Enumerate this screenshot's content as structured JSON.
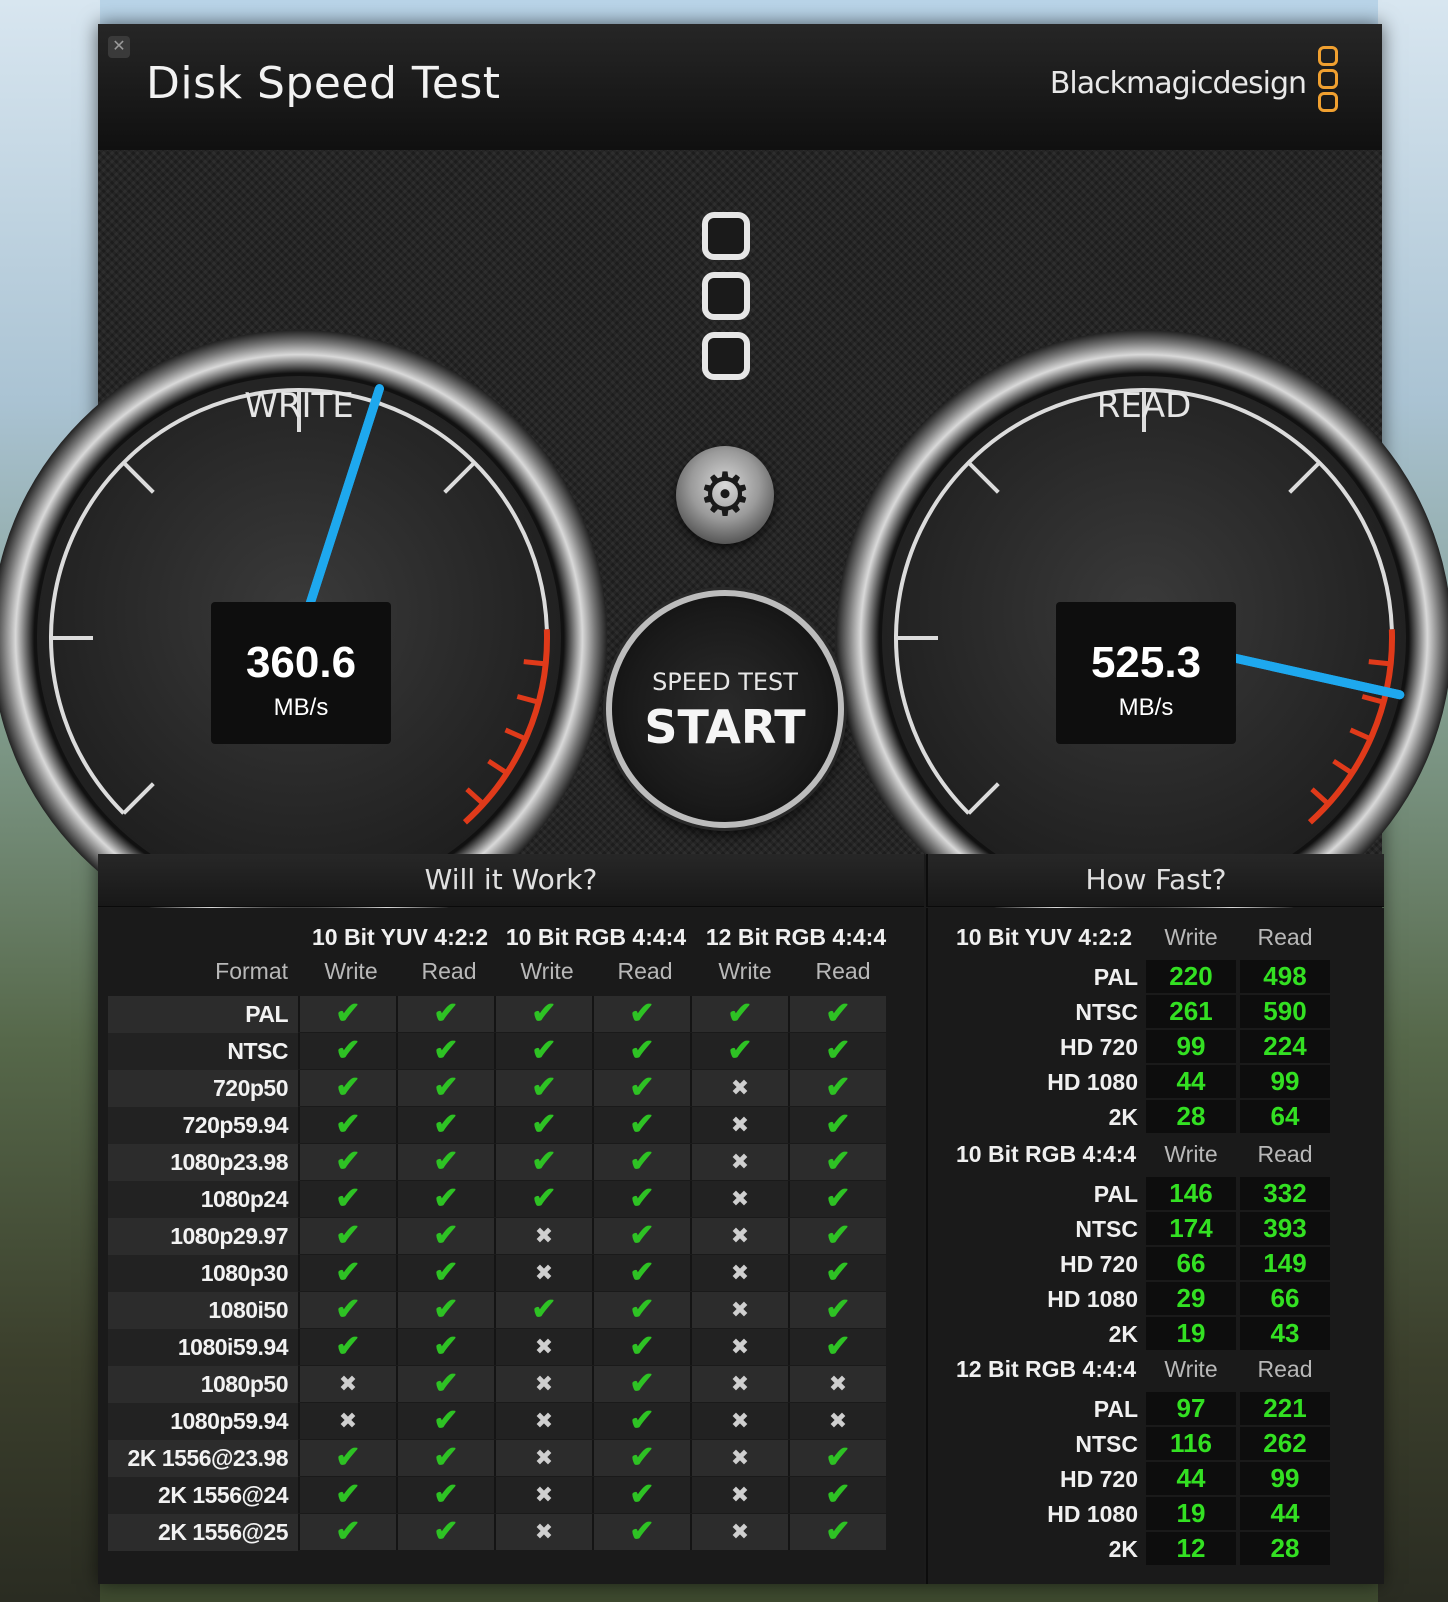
{
  "window": {
    "title": "Disk Speed Test",
    "brand": "Blackmagicdesign",
    "close_glyph": "✕"
  },
  "gauges": {
    "write": {
      "label": "WRITE",
      "value": "360.6",
      "unit": "MB/s",
      "needle_fraction": 0.56
    },
    "read": {
      "label": "READ",
      "value": "525.3",
      "unit": "MB/s",
      "needle_fraction": 0.87
    }
  },
  "controls": {
    "settings_icon": "gear-icon",
    "start_small": "SPEED TEST",
    "start_big": "START"
  },
  "colors": {
    "needle": "#1ea8ee",
    "redzone": "#e03a1a",
    "check": "#2ec224",
    "fast_value": "#33e022",
    "brand_accent": "#f0a030"
  },
  "will_it_work": {
    "title": "Will it Work?",
    "format_header": "Format",
    "groups": [
      "10 Bit YUV 4:2:2",
      "10 Bit RGB 4:4:4",
      "12 Bit RGB 4:4:4"
    ],
    "subheaders": [
      "Write",
      "Read",
      "Write",
      "Read",
      "Write",
      "Read"
    ],
    "rows": [
      {
        "format": "PAL",
        "cells": [
          1,
          1,
          1,
          1,
          1,
          1
        ]
      },
      {
        "format": "NTSC",
        "cells": [
          1,
          1,
          1,
          1,
          1,
          1
        ]
      },
      {
        "format": "720p50",
        "cells": [
          1,
          1,
          1,
          1,
          0,
          1
        ]
      },
      {
        "format": "720p59.94",
        "cells": [
          1,
          1,
          1,
          1,
          0,
          1
        ]
      },
      {
        "format": "1080p23.98",
        "cells": [
          1,
          1,
          1,
          1,
          0,
          1
        ]
      },
      {
        "format": "1080p24",
        "cells": [
          1,
          1,
          1,
          1,
          0,
          1
        ]
      },
      {
        "format": "1080p29.97",
        "cells": [
          1,
          1,
          0,
          1,
          0,
          1
        ]
      },
      {
        "format": "1080p30",
        "cells": [
          1,
          1,
          0,
          1,
          0,
          1
        ]
      },
      {
        "format": "1080i50",
        "cells": [
          1,
          1,
          1,
          1,
          0,
          1
        ]
      },
      {
        "format": "1080i59.94",
        "cells": [
          1,
          1,
          0,
          1,
          0,
          1
        ]
      },
      {
        "format": "1080p50",
        "cells": [
          0,
          1,
          0,
          1,
          0,
          0
        ]
      },
      {
        "format": "1080p59.94",
        "cells": [
          0,
          1,
          0,
          1,
          0,
          0
        ]
      },
      {
        "format": "2K 1556@23.98",
        "cells": [
          1,
          1,
          0,
          1,
          0,
          1
        ]
      },
      {
        "format": "2K 1556@24",
        "cells": [
          1,
          1,
          0,
          1,
          0,
          1
        ]
      },
      {
        "format": "2K 1556@25",
        "cells": [
          1,
          1,
          0,
          1,
          0,
          1
        ]
      }
    ]
  },
  "how_fast": {
    "title": "How Fast?",
    "write_header": "Write",
    "read_header": "Read",
    "groups": [
      {
        "name": "10 Bit YUV 4:2:2",
        "rows": [
          {
            "label": "PAL",
            "write": "220",
            "read": "498"
          },
          {
            "label": "NTSC",
            "write": "261",
            "read": "590"
          },
          {
            "label": "HD 720",
            "write": "99",
            "read": "224"
          },
          {
            "label": "HD 1080",
            "write": "44",
            "read": "99"
          },
          {
            "label": "2K",
            "write": "28",
            "read": "64"
          }
        ]
      },
      {
        "name": "10 Bit RGB 4:4:4",
        "rows": [
          {
            "label": "PAL",
            "write": "146",
            "read": "332"
          },
          {
            "label": "NTSC",
            "write": "174",
            "read": "393"
          },
          {
            "label": "HD 720",
            "write": "66",
            "read": "149"
          },
          {
            "label": "HD 1080",
            "write": "29",
            "read": "66"
          },
          {
            "label": "2K",
            "write": "19",
            "read": "43"
          }
        ]
      },
      {
        "name": "12 Bit RGB 4:4:4",
        "rows": [
          {
            "label": "PAL",
            "write": "97",
            "read": "221"
          },
          {
            "label": "NTSC",
            "write": "116",
            "read": "262"
          },
          {
            "label": "HD 720",
            "write": "44",
            "read": "99"
          },
          {
            "label": "HD 1080",
            "write": "19",
            "read": "44"
          },
          {
            "label": "2K",
            "write": "12",
            "read": "28"
          }
        ]
      }
    ]
  }
}
